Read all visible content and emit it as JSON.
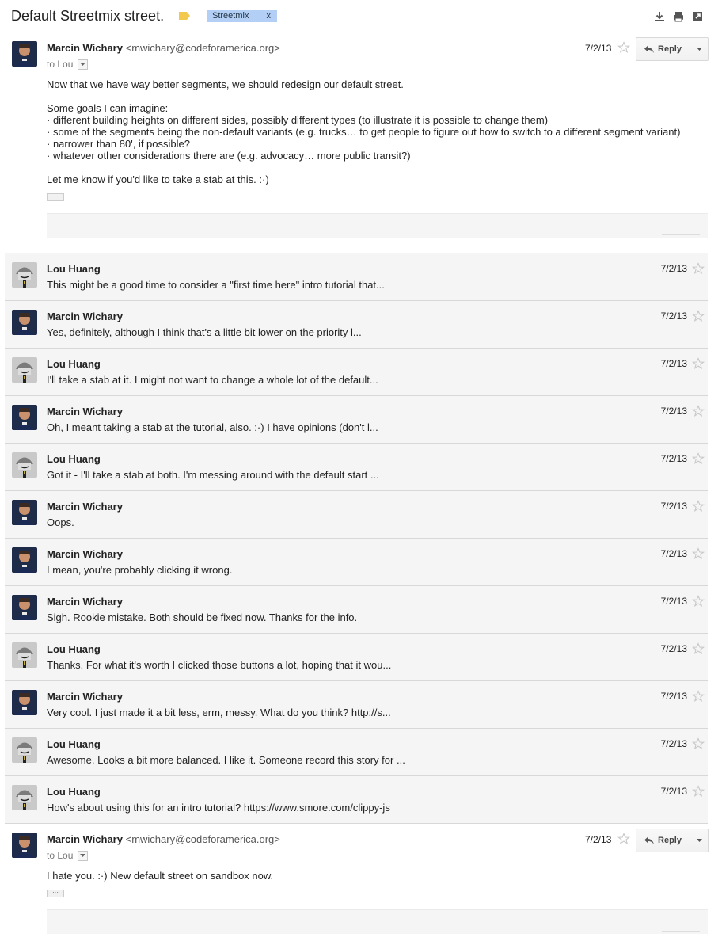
{
  "thread": {
    "subject": "Default Streetmix street.",
    "label": "Streetmix",
    "label_remove": "x",
    "label_color": "#b3cff5",
    "important_color": "#f2c94c"
  },
  "header_icons": [
    "download-icon",
    "print-icon",
    "new-window-icon"
  ],
  "expanded_first": {
    "sender_name": "Marcin Wichary",
    "sender_email": "<mwichary@codeforamerica.org>",
    "to": "to Lou",
    "date": "7/2/13",
    "reply_label": "Reply",
    "body": "Now that we have way better segments, we should redesign our default street.\n\nSome goals I can imagine:\n· different building heights on different sides, possibly different types (to illustrate it is possible to change them)\n· some of the segments being the non-default variants (e.g. trucks… to get people to figure out how to switch to a different segment variant)\n· narrower than 80', if possible?\n· whatever other considerations there are (e.g. advocacy… more public transit?)\n\nLet me know if you'd like to take a stab at this. :·)",
    "ellipsis": "···"
  },
  "collapsed": [
    {
      "name": "Lou Huang",
      "avatar": "lou",
      "date": "7/2/13",
      "snippet": "This might be a good time to consider a \"first time here\" intro tutorial that..."
    },
    {
      "name": "Marcin Wichary",
      "avatar": "marcin",
      "date": "7/2/13",
      "snippet": "Yes, definitely, although I think that's a little bit lower on the priority l..."
    },
    {
      "name": "Lou Huang",
      "avatar": "lou",
      "date": "7/2/13",
      "snippet": "I'll take a stab at it. I might not want to change a whole lot of the default..."
    },
    {
      "name": "Marcin Wichary",
      "avatar": "marcin",
      "date": "7/2/13",
      "snippet": "Oh, I meant taking a stab at the tutorial, also. :·) I have opinions (don't l..."
    },
    {
      "name": "Lou Huang",
      "avatar": "lou",
      "date": "7/2/13",
      "snippet": "Got it - I'll take a stab at both. I'm messing around with the default start ..."
    },
    {
      "name": "Marcin Wichary",
      "avatar": "marcin",
      "date": "7/2/13",
      "snippet": "Oops."
    },
    {
      "name": "Marcin Wichary",
      "avatar": "marcin",
      "date": "7/2/13",
      "snippet": "I mean, you're probably clicking it wrong."
    },
    {
      "name": "Marcin Wichary",
      "avatar": "marcin",
      "date": "7/2/13",
      "snippet": "Sigh. Rookie mistake. Both should be fixed now. Thanks for the info."
    },
    {
      "name": "Lou Huang",
      "avatar": "lou",
      "date": "7/2/13",
      "snippet": "Thanks. For what it's worth I clicked those buttons a lot, hoping that it wou..."
    },
    {
      "name": "Marcin Wichary",
      "avatar": "marcin",
      "date": "7/2/13",
      "snippet": "Very cool. I just made it a bit less, erm, messy. What do you think? http://s..."
    },
    {
      "name": "Lou Huang",
      "avatar": "lou",
      "date": "7/2/13",
      "snippet": "Awesome. Looks a bit more balanced. I like it. Someone record this story for ..."
    },
    {
      "name": "Lou Huang",
      "avatar": "lou",
      "date": "7/2/13",
      "snippet": "How's about using this for an intro tutorial? https://www.smore.com/clippy-js"
    }
  ],
  "expanded_last": {
    "sender_name": "Marcin Wichary",
    "sender_email": "<mwichary@codeforamerica.org>",
    "to": "to Lou",
    "date": "7/2/13",
    "reply_label": "Reply",
    "body": "I hate you. :·) New default street on sandbox now.",
    "ellipsis": "···"
  }
}
